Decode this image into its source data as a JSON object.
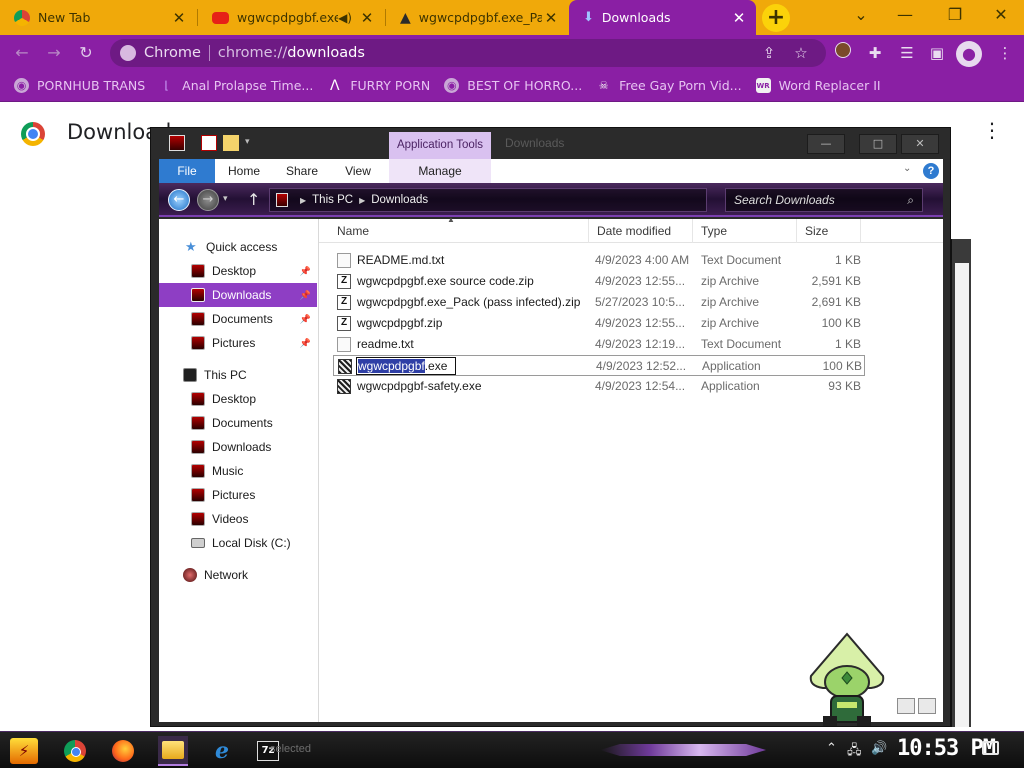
{
  "browser": {
    "tabs": [
      {
        "title": "New Tab",
        "favicon": "chrome-icon",
        "active": false
      },
      {
        "title": "wgwcpdpgbf.exe",
        "favicon": "youtube-icon",
        "audio": true,
        "active": false
      },
      {
        "title": "wgwcpdpgbf.exe_Pack",
        "favicon": "warning-icon",
        "active": false
      },
      {
        "title": "Downloads",
        "favicon": "download-icon",
        "active": true
      }
    ],
    "omnibox": {
      "chip": "Chrome",
      "scheme": "chrome://",
      "host": "downloads"
    },
    "bookmarks": [
      {
        "label": "PORNHUB TRANS",
        "icon": "globe-icon"
      },
      {
        "label": "Anal Prolapse Time...",
        "icon": "bracket-icon"
      },
      {
        "label": "FURRY PORN",
        "icon": "lambda-icon"
      },
      {
        "label": "BEST OF HORRO...",
        "icon": "globe-icon"
      },
      {
        "label": "Free Gay Porn Vid...",
        "icon": "figure-icon"
      },
      {
        "label": "Word Replacer II",
        "icon": "wr-icon"
      }
    ],
    "colors": {
      "tabstrip": "#f0a90a",
      "theme": "#8a1fa4"
    }
  },
  "downloads_page": {
    "title": "Downloads"
  },
  "explorer": {
    "title": "Downloads",
    "contextual_tab_group": "Application Tools",
    "ribbon_tabs": [
      "File",
      "Home",
      "Share",
      "View",
      "Manage"
    ],
    "breadcrumb": [
      "This PC",
      "Downloads"
    ],
    "search_placeholder": "Search Downloads",
    "nav": {
      "quick_access": "Quick access",
      "quick_items": [
        {
          "label": "Desktop",
          "pinned": true
        },
        {
          "label": "Downloads",
          "pinned": true,
          "selected": true
        },
        {
          "label": "Documents",
          "pinned": true
        },
        {
          "label": "Pictures",
          "pinned": true
        }
      ],
      "this_pc": "This PC",
      "pc_items": [
        "Desktop",
        "Documents",
        "Downloads",
        "Music",
        "Pictures",
        "Videos",
        "Local Disk (C:)"
      ],
      "network": "Network"
    },
    "columns": [
      "Name",
      "Date modified",
      "Type",
      "Size"
    ],
    "files": [
      {
        "name": "README.md.txt",
        "date": "4/9/2023 4:00 AM",
        "type": "Text Document",
        "size": "1 KB",
        "icon": "text-file-icon"
      },
      {
        "name": "wgwcpdpgbf.exe source code.zip",
        "date": "4/9/2023 12:55...",
        "type": "zip Archive",
        "size": "2,591 KB",
        "icon": "zip-icon"
      },
      {
        "name": "wgwcpdpgbf.exe_Pack (pass infected).zip",
        "date": "5/27/2023 10:5...",
        "type": "zip Archive",
        "size": "2,691 KB",
        "icon": "zip-icon"
      },
      {
        "name": "wgwcpdpgbf.zip",
        "date": "4/9/2023 12:55...",
        "type": "zip Archive",
        "size": "100 KB",
        "icon": "zip-icon"
      },
      {
        "name": "readme.txt",
        "date": "4/9/2023 12:19...",
        "type": "Text Document",
        "size": "1 KB",
        "icon": "text-file-icon"
      },
      {
        "name": "wgwcpdpgbf.exe",
        "date": "4/9/2023 12:52...",
        "type": "Application",
        "size": "100 KB",
        "icon": "exe-icon",
        "selected": true,
        "renaming": true
      },
      {
        "name": "wgwcpdpgbf-safety.exe",
        "date": "4/9/2023 12:54...",
        "type": "Application",
        "size": "93 KB",
        "icon": "exe-icon"
      }
    ],
    "rename": {
      "selected_part": "wgwcpdpgbf",
      "extension": ".exe"
    }
  },
  "taskbar": {
    "status_text": "selected",
    "apps": [
      "start-icon",
      "chrome-icon",
      "firefox-icon",
      "file-explorer-icon",
      "internet-explorer-icon",
      "7zip-icon"
    ],
    "clock": "10:53 PM",
    "sevenzip_label": "7z",
    "ie_label": "e"
  }
}
